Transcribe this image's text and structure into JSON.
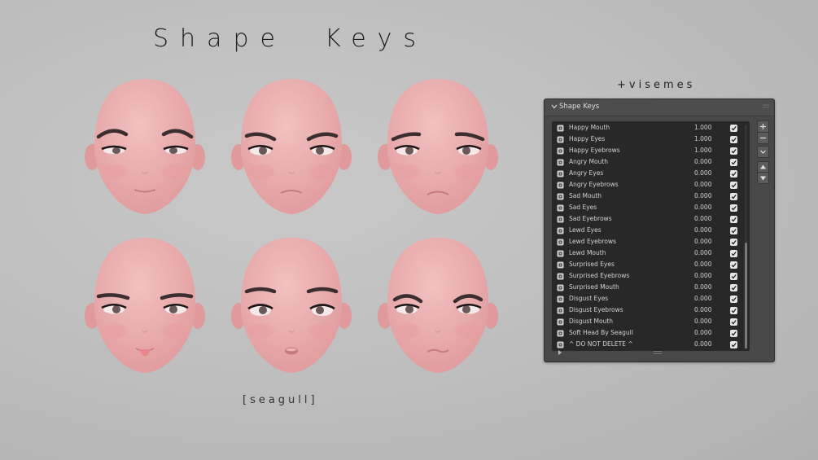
{
  "title": "Shape  Keys",
  "visemes_label": "+visemes",
  "credit": "[seagull]",
  "panel": {
    "title": "Shape Keys",
    "shape_keys": [
      {
        "name": "Happy Mouth",
        "value": "1.000",
        "checked": true
      },
      {
        "name": "Happy Eyes",
        "value": "1.000",
        "checked": true
      },
      {
        "name": "Happy Eyebrows",
        "value": "1.000",
        "checked": true
      },
      {
        "name": "Angry Mouth",
        "value": "0.000",
        "checked": true
      },
      {
        "name": "Angry Eyes",
        "value": "0.000",
        "checked": true
      },
      {
        "name": "Angry Eyebrows",
        "value": "0.000",
        "checked": true
      },
      {
        "name": "Sad Mouth",
        "value": "0.000",
        "checked": true
      },
      {
        "name": "Sad Eyes",
        "value": "0.000",
        "checked": true
      },
      {
        "name": "Sad Eyebrows",
        "value": "0.000",
        "checked": true
      },
      {
        "name": "Lewd Eyes",
        "value": "0.000",
        "checked": true
      },
      {
        "name": "Lewd Eyebrows",
        "value": "0.000",
        "checked": true
      },
      {
        "name": "Lewd Mouth",
        "value": "0.000",
        "checked": true
      },
      {
        "name": "Surprised Eyes",
        "value": "0.000",
        "checked": true
      },
      {
        "name": "Surprised Eyebrows",
        "value": "0.000",
        "checked": true
      },
      {
        "name": "Surprised Mouth",
        "value": "0.000",
        "checked": true
      },
      {
        "name": "Disgust Eyes",
        "value": "0.000",
        "checked": true
      },
      {
        "name": "Disgust Eyebrows",
        "value": "0.000",
        "checked": true
      },
      {
        "name": "Disgust Mouth",
        "value": "0.000",
        "checked": true
      },
      {
        "name": "Soft Head By Seagull",
        "value": "0.000",
        "checked": true
      },
      {
        "name": "^ DO NOT DELETE ^",
        "value": "0.000",
        "checked": true
      }
    ],
    "side_buttons": [
      "plus-icon",
      "minus-icon",
      "chevron-down-icon",
      "arrow-up-icon",
      "arrow-down-icon"
    ]
  },
  "faces": [
    {
      "expression": "happy"
    },
    {
      "expression": "angry"
    },
    {
      "expression": "sad"
    },
    {
      "expression": "lewd"
    },
    {
      "expression": "surprised"
    },
    {
      "expression": "disgust"
    }
  ],
  "colors": {
    "skin": "#f2c1c0",
    "skin_shadow": "#e09a9c",
    "panel_bg": "#484848",
    "list_bg": "#282828",
    "checkbox": "#e6e6e6"
  }
}
